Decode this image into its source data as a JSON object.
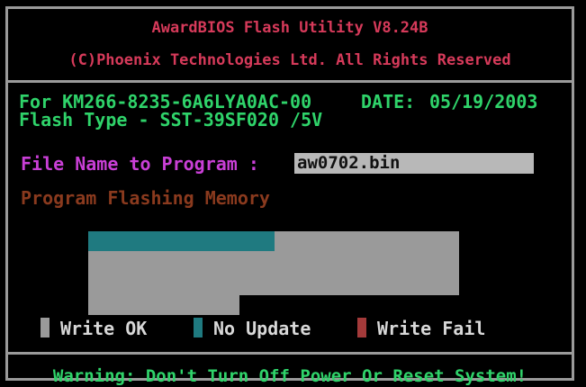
{
  "header": {
    "title": "AwardBIOS Flash Utility V8.24B",
    "copyright": "(C)Phoenix Technologies Ltd. All Rights Reserved"
  },
  "info": {
    "board_line": "For KM266-8235-6A6LYA0AC-00",
    "date_label": "DATE:",
    "date_value": "05/19/2003",
    "flash_type": "Flash Type - SST-39SF020 /5V"
  },
  "file": {
    "label": "File Name to Program :",
    "value": "aw0702.bin"
  },
  "status": {
    "message": "Program Flashing Memory"
  },
  "progress": {
    "no_update_fraction": 0.28,
    "write_ok_fraction": 0.72
  },
  "legend": {
    "write_ok": "Write OK",
    "no_update": "No Update",
    "write_fail": "Write Fail"
  },
  "colors": {
    "write_ok": "#9a9a9a",
    "no_update": "#1f7a80",
    "write_fail": "#a33a3a",
    "header_text": "#d63a5a",
    "info_text": "#2fd36a",
    "file_label": "#c93fd6",
    "status_text": "#8a3a1e"
  },
  "footer": {
    "warning": "Warning: Don't Turn Off Power Or Reset System!"
  }
}
